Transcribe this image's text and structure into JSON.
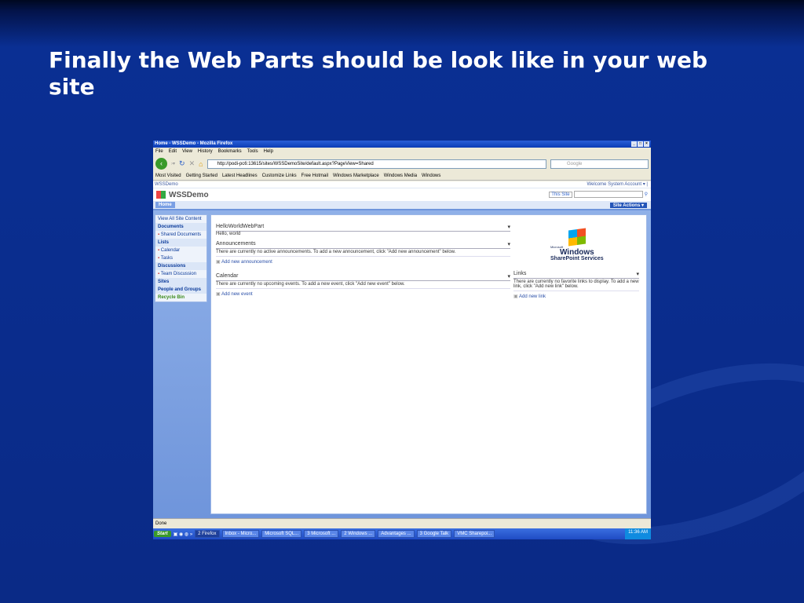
{
  "slide": {
    "title": "Finally the Web Parts should be look like in your web site"
  },
  "browser": {
    "title": "Home - WSSDemo - Mozilla Firefox",
    "menu": [
      "File",
      "Edit",
      "View",
      "History",
      "Bookmarks",
      "Tools",
      "Help"
    ],
    "url": "http://podi-pc6:13615/sites/WSSDemoSite/default.aspx?PageView=Shared",
    "search_placeholder": "Google",
    "bookmarks": [
      "Most Visited",
      "Getting Started",
      "Latest Headlines",
      "Customize Links",
      "Free Hotmail",
      "Windows Marketplace",
      "Windows Media",
      "Windows"
    ],
    "status": "Done"
  },
  "sp": {
    "crumb": "WSSDemo",
    "welcome": "Welcome System Account ▾ |",
    "site_name": "WSSDemo",
    "scope": "This Site",
    "tab_home": "Home",
    "site_actions": "Site Actions ▾",
    "nav": [
      {
        "t": "View All Site Content",
        "k": "l"
      },
      {
        "t": "Documents",
        "k": "h"
      },
      {
        "t": "Shared Documents",
        "k": "i"
      },
      {
        "t": "Lists",
        "k": "h"
      },
      {
        "t": "Calendar",
        "k": "i"
      },
      {
        "t": "Tasks",
        "k": "i"
      },
      {
        "t": "Discussions",
        "k": "h"
      },
      {
        "t": "Team Discussion",
        "k": "i"
      },
      {
        "t": "Sites",
        "k": "h"
      },
      {
        "t": "People and Groups",
        "k": "h"
      },
      {
        "t": "Recycle Bin",
        "k": "rb"
      }
    ],
    "hello": {
      "title": "HelloWorldWebPart",
      "body": "Hello, world"
    },
    "ann": {
      "title": "Announcements",
      "body": "There are currently no active announcements. To add a new announcement, click \"Add new announcement\" below.",
      "add": "Add new announcement"
    },
    "cal": {
      "title": "Calendar",
      "body": "There are currently no upcoming events. To add a new event, click \"Add new event\" below.",
      "add": "Add new event"
    },
    "links": {
      "title": "Links",
      "body": "There are currently no favorite links to display. To add a new link, click \"Add new link\" below.",
      "add": "Add new link"
    },
    "logo": {
      "ms": "Microsoft",
      "win": "Windows",
      "sps": "SharePoint Services"
    }
  },
  "taskbar": {
    "start": "Start",
    "buttons": [
      "2 Firefox",
      "Inbox - Micro...",
      "Microsoft SQL...",
      "3 Microsoft ...",
      "2 Windows ...",
      "Advantages ...",
      "3 Google Talk",
      "VMC Sharepoi..."
    ],
    "clock": "11:36 AM"
  }
}
